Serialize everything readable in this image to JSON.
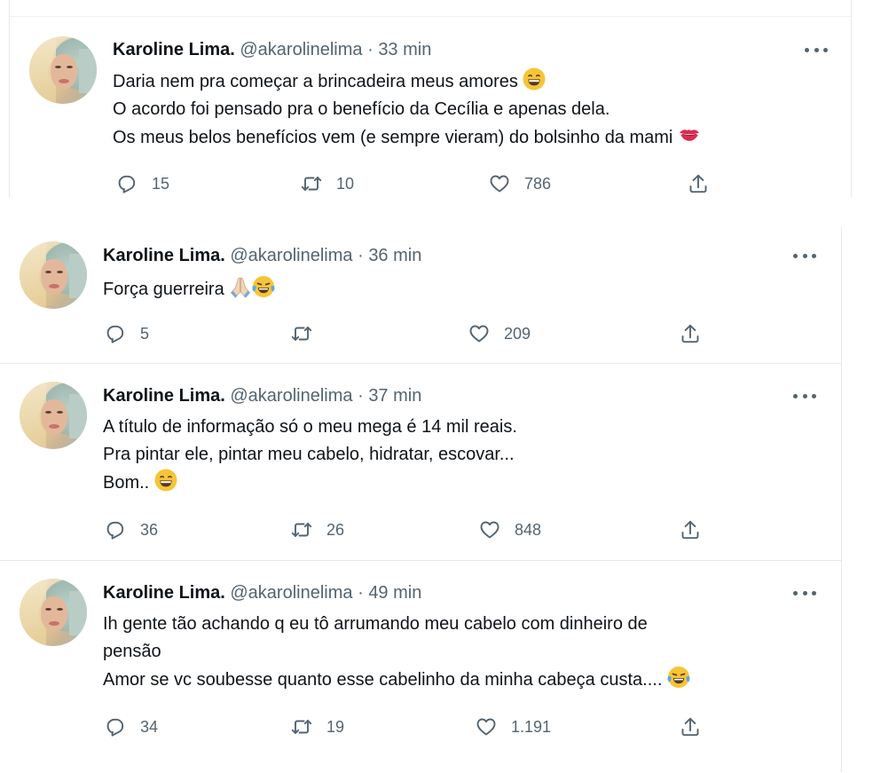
{
  "tweets": [
    {
      "name": "Karoline Lima.",
      "handle": "@akarolinelima",
      "time": "33 min",
      "lines": [
        "Daria nem pra começar a brincadeira meus amores",
        "O acordo foi pensado pra o benefício da Cecília e apenas dela.",
        "Os meus belos benefícios vem (e sempre vieram) do bolsinho da mami"
      ],
      "emojis": [
        "grinning-face-emoji",
        "kiss-mark-emoji"
      ],
      "replies": "15",
      "retweets": "10",
      "likes": "786"
    },
    {
      "name": "Karoline Lima.",
      "handle": "@akarolinelima",
      "time": "36 min",
      "lines": [
        "Força guerreira"
      ],
      "emojis": [
        "folded-hands-emoji",
        "tears-of-joy-emoji"
      ],
      "replies": "5",
      "retweets": "",
      "likes": "209"
    },
    {
      "name": "Karoline Lima.",
      "handle": "@akarolinelima",
      "time": "37 min",
      "lines": [
        "A título de informação só o meu mega é 14 mil reais.",
        "Pra pintar ele, pintar meu cabelo, hidratar, escovar...",
        "Bom.."
      ],
      "emojis": [
        "grinning-face-emoji"
      ],
      "replies": "36",
      "retweets": "26",
      "likes": "848"
    },
    {
      "name": "Karoline Lima.",
      "handle": "@akarolinelima",
      "time": "49 min",
      "lines": [
        "Ih gente tão achando q eu tô arrumando meu cabelo com dinheiro de",
        "pensão",
        "Amor se vc soubesse quanto esse cabelinho da minha cabeça custa...."
      ],
      "emojis": [
        "tears-of-joy-emoji"
      ],
      "replies": "34",
      "retweets": "19",
      "likes": "1.191"
    }
  ],
  "separator": "·",
  "icons": {
    "reply": "reply-icon",
    "retweet": "retweet-icon",
    "like": "heart-icon",
    "share": "share-icon",
    "more": "more-options-icon"
  },
  "colors": {
    "text": "#0f1419",
    "secondary": "#536471",
    "divider": "#e7e9ea"
  }
}
